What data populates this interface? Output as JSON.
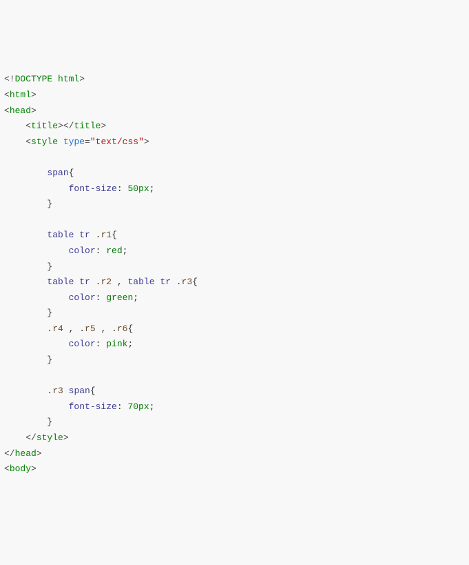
{
  "code": {
    "l01": {
      "a": "<!",
      "b": "DOCTYPE",
      "c": " ",
      "d": "html",
      "e": ">"
    },
    "l02": {
      "a": "<",
      "b": "html",
      "c": ">"
    },
    "l03": {
      "a": "<",
      "b": "head",
      "c": ">"
    },
    "l04": {
      "a": "    <",
      "b": "title",
      "c": "></",
      "d": "title",
      "e": ">"
    },
    "l05": {
      "a": "    <",
      "b": "style",
      "c": " ",
      "d": "type",
      "e": "=",
      "f": "\"text/css\"",
      "g": ">"
    },
    "l06": {
      "a": ""
    },
    "l07": {
      "a": "        ",
      "b": "span",
      "c": "{"
    },
    "l08": {
      "a": "            ",
      "b": "font-size",
      "c": ": ",
      "d": "50px",
      "e": ";"
    },
    "l09": {
      "a": "        ",
      "b": "}"
    },
    "l10": {
      "a": ""
    },
    "l11": {
      "a": "        ",
      "b": "table",
      "c": " ",
      "d": "tr",
      "e": " .",
      "f": "r1",
      "g": "{"
    },
    "l12": {
      "a": "            ",
      "b": "color",
      "c": ": ",
      "d": "red",
      "e": ";"
    },
    "l13": {
      "a": "        ",
      "b": "}"
    },
    "l14": {
      "a": "        ",
      "b": "table",
      "c": " ",
      "d": "tr",
      "e": " .",
      "f": "r2",
      "g": " , ",
      "h": "table",
      "i": " ",
      "j": "tr",
      "k": " .",
      "l": "r3",
      "m": "{"
    },
    "l15": {
      "a": "            ",
      "b": "color",
      "c": ": ",
      "d": "green",
      "e": ";"
    },
    "l16": {
      "a": "        ",
      "b": "}"
    },
    "l17": {
      "a": "        .",
      "b": "r4",
      "c": " , .",
      "d": "r5",
      "e": " , .",
      "f": "r6",
      "g": "{"
    },
    "l18": {
      "a": "            ",
      "b": "color",
      "c": ": ",
      "d": "pink",
      "e": ";"
    },
    "l19": {
      "a": "        ",
      "b": "}"
    },
    "l20": {
      "a": ""
    },
    "l21": {
      "a": "        .",
      "b": "r3",
      "c": " ",
      "d": "span",
      "e": "{"
    },
    "l22": {
      "a": "            ",
      "b": "font-size",
      "c": ": ",
      "d": "70px",
      "e": ";"
    },
    "l23": {
      "a": "        ",
      "b": "}"
    },
    "l24": {
      "a": "    </",
      "b": "style",
      "c": ">"
    },
    "l25": {
      "a": "</",
      "b": "head",
      "c": ">"
    },
    "l26": {
      "a": "<",
      "b": "body",
      "c": ">"
    }
  }
}
